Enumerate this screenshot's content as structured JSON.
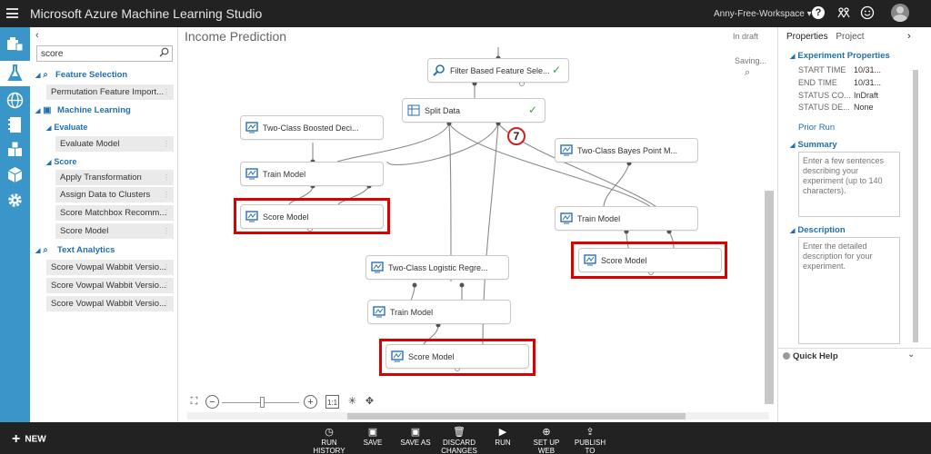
{
  "app": {
    "title": "Microsoft Azure Machine Learning Studio",
    "workspace": "Anny-Free-Workspace ▾"
  },
  "palette": {
    "search_value": "score",
    "rows": [
      {
        "kind": "cat",
        "label": "Feature Selection",
        "icon": "funnel-search-icon"
      },
      {
        "kind": "item",
        "label": "Permutation Feature Import..."
      },
      {
        "kind": "cat",
        "label": "Machine Learning",
        "icon": "ml-monitor-icon"
      },
      {
        "kind": "sub",
        "label": "Evaluate"
      },
      {
        "kind": "item2",
        "label": "Evaluate Model"
      },
      {
        "kind": "sub",
        "label": "Score"
      },
      {
        "kind": "item2",
        "label": "Apply Transformation"
      },
      {
        "kind": "item2",
        "label": "Assign Data to Clusters"
      },
      {
        "kind": "item2",
        "label": "Score Matchbox Recomm..."
      },
      {
        "kind": "item2",
        "label": "Score Model"
      },
      {
        "kind": "cat",
        "label": "Text Analytics",
        "icon": "text-analytics-icon"
      },
      {
        "kind": "item",
        "label": "Score Vowpal Wabbit Versio..."
      },
      {
        "kind": "item",
        "label": "Score Vowpal Wabbit Versio..."
      },
      {
        "kind": "item",
        "label": "Score Vowpal Wabbit Versio..."
      }
    ]
  },
  "canvas": {
    "experiment_title": "Income Prediction",
    "status": "In draft",
    "saving": "Saving...",
    "step_badge": "7",
    "modules": [
      {
        "id": "filter",
        "label": "Filter Based Feature Sele...",
        "check": true
      },
      {
        "id": "split",
        "label": "Split Data",
        "check": true
      },
      {
        "id": "boosted",
        "label": "Two-Class Boosted Deci..."
      },
      {
        "id": "train1",
        "label": "Train Model"
      },
      {
        "id": "score1",
        "label": "Score Model"
      },
      {
        "id": "bayes",
        "label": "Two-Class Bayes Point M..."
      },
      {
        "id": "train2",
        "label": "Train Model"
      },
      {
        "id": "score2",
        "label": "Score Model"
      },
      {
        "id": "logistic",
        "label": "Two-Class Logistic Regre..."
      },
      {
        "id": "train3",
        "label": "Train Model"
      },
      {
        "id": "score3",
        "label": "Score Model"
      }
    ],
    "zoom_actual": "1:1"
  },
  "properties": {
    "tab_properties": "Properties",
    "tab_project": "Project",
    "section_experiment": "Experiment Properties",
    "fields": [
      {
        "key": "START TIME",
        "value": "10/31..."
      },
      {
        "key": "END TIME",
        "value": "10/31..."
      },
      {
        "key": "STATUS CO...",
        "value": "InDraft"
      },
      {
        "key": "STATUS DE...",
        "value": "None"
      }
    ],
    "prior_run": "Prior Run",
    "section_summary": "Summary",
    "summary_placeholder": "Enter a few sentences describing your experiment (up to 140 characters).",
    "section_description": "Description",
    "description_placeholder": "Enter the detailed description for your experiment.",
    "quick_help": "Quick Help"
  },
  "bottombar": {
    "new_label": "NEW",
    "commands": [
      {
        "label": "RUN HISTORY",
        "icon": "clock-icon"
      },
      {
        "label": "SAVE",
        "icon": "save-icon"
      },
      {
        "label": "SAVE AS",
        "icon": "save-as-icon"
      },
      {
        "label": "DISCARD CHANGES",
        "icon": "trash-icon"
      },
      {
        "label": "RUN",
        "icon": "play-icon"
      },
      {
        "label": "SET UP WEB SERVICE",
        "icon": "globe-icon"
      },
      {
        "label": "PUBLISH TO GALLERY",
        "icon": "publish-icon"
      }
    ]
  },
  "colors": {
    "accent": "#3a95c8",
    "link": "#1f6fb2",
    "highlight": "#dd0000",
    "topbar": "#222222"
  }
}
